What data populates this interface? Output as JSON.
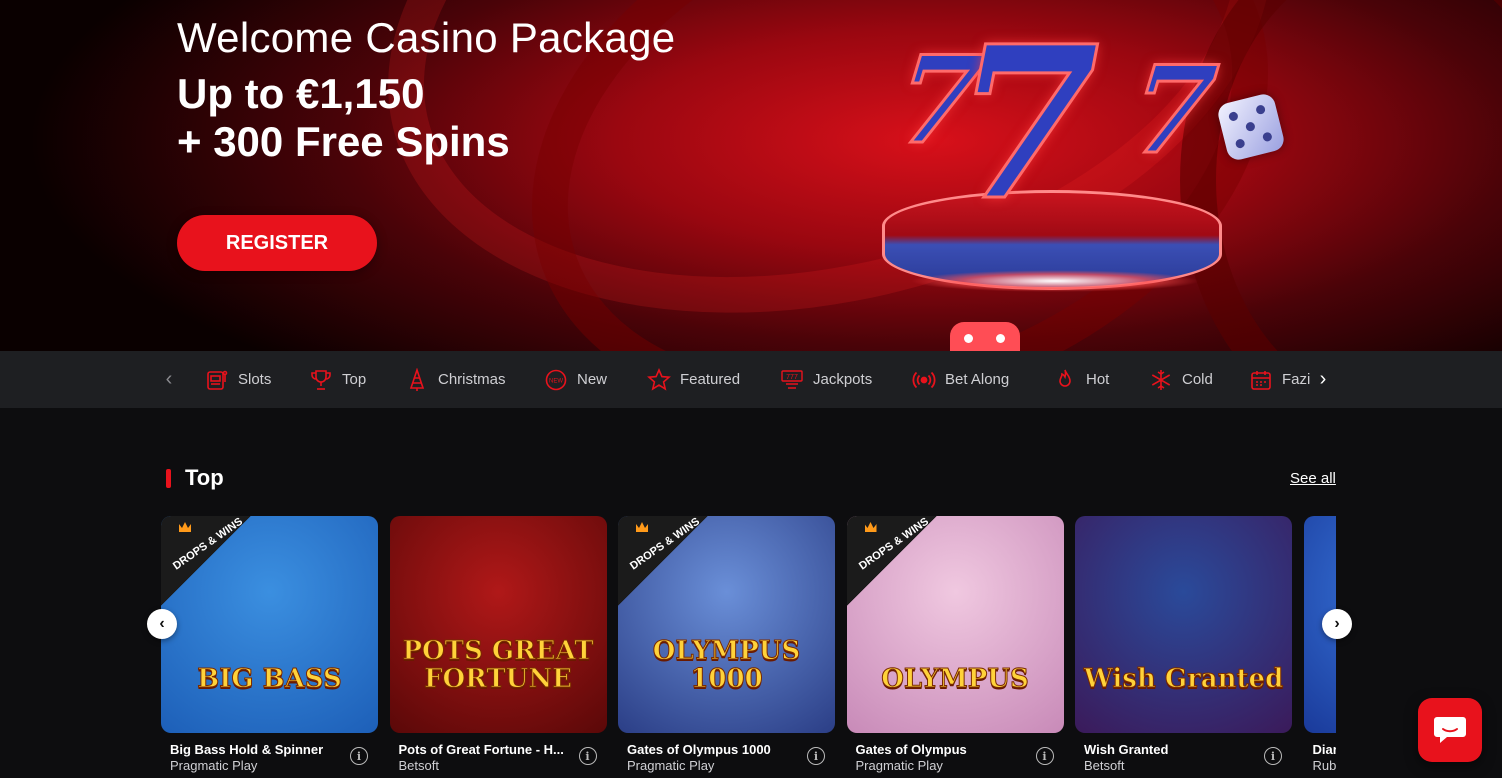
{
  "hero": {
    "title": "Welcome Casino Package",
    "amount": "Up to €1,150",
    "spins": "+ 300 Free Spins",
    "register_label": "REGISTER",
    "art_text": "777"
  },
  "categories": [
    {
      "label": "Slots",
      "icon": "slot-machine-icon"
    },
    {
      "label": "Top",
      "icon": "trophy-icon"
    },
    {
      "label": "Christmas",
      "icon": "christmas-tree-icon"
    },
    {
      "label": "New",
      "icon": "new-badge-icon"
    },
    {
      "label": "Featured",
      "icon": "star-icon"
    },
    {
      "label": "Jackpots",
      "icon": "jackpot-icon"
    },
    {
      "label": "Bet Along",
      "icon": "broadcast-icon"
    },
    {
      "label": "Hot",
      "icon": "flame-icon"
    },
    {
      "label": "Cold",
      "icon": "snowflake-icon"
    },
    {
      "label": "Fazi",
      "icon": "calendar-icon"
    }
  ],
  "section": {
    "title": "Top",
    "see_all": "See all"
  },
  "games": [
    {
      "name": "Big Bass Hold & Spinner",
      "provider": "Pragmatic Play",
      "art": "BIG BASS",
      "drops_wins": true,
      "colors": [
        "#3b8fe0",
        "#1d5fb8"
      ]
    },
    {
      "name": "Pots of Great Fortune - H...",
      "provider": "Betsoft",
      "art": "POTS GREAT FORTUNE",
      "drops_wins": false,
      "colors": [
        "#b01818",
        "#5a0808"
      ]
    },
    {
      "name": "Gates of Olympus 1000",
      "provider": "Pragmatic Play",
      "art": "OLYMPUS 1000",
      "drops_wins": true,
      "colors": [
        "#6a8fd8",
        "#2b3e86"
      ]
    },
    {
      "name": "Gates of Olympus",
      "provider": "Pragmatic Play",
      "art": "OLYMPUS",
      "drops_wins": true,
      "colors": [
        "#f0c8e0",
        "#c88ab8"
      ]
    },
    {
      "name": "Wish Granted",
      "provider": "Betsoft",
      "art": "Wish Granted",
      "drops_wins": false,
      "colors": [
        "#2a4a9a",
        "#3b1a5a"
      ]
    },
    {
      "name": "Diar",
      "provider": "Rub",
      "art": "",
      "drops_wins": false,
      "colors": [
        "#3a7ae0",
        "#1a3a9a"
      ]
    }
  ],
  "drops_wins_text": "DROPS & WINS",
  "accent": "#e8121c"
}
